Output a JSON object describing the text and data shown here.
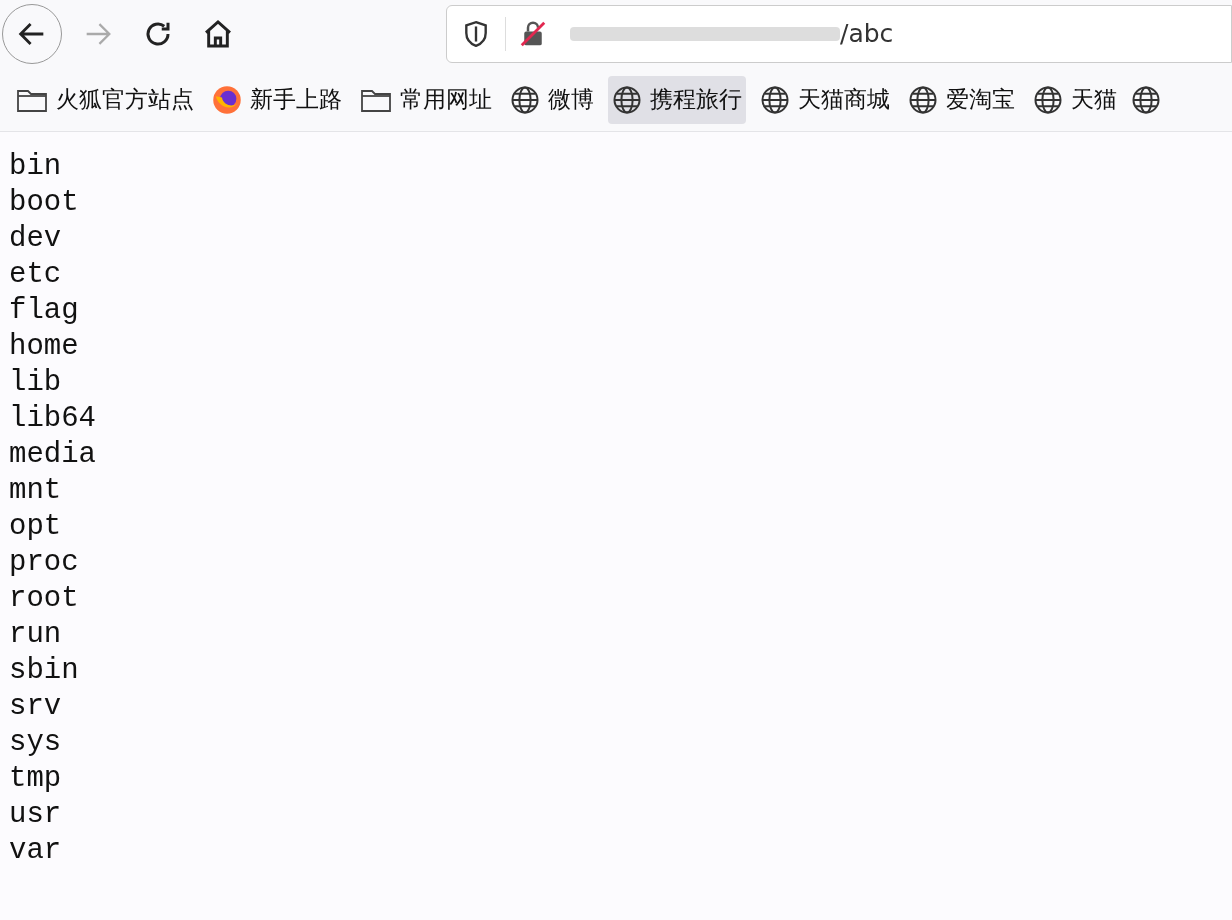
{
  "toolbar": {
    "back_enabled": true,
    "forward_enabled": false,
    "url": "/abc"
  },
  "bookmarks": [
    {
      "kind": "folder",
      "label": "火狐官方站点",
      "selected": false
    },
    {
      "kind": "firefox",
      "label": "新手上路",
      "selected": false
    },
    {
      "kind": "folder",
      "label": "常用网址",
      "selected": false
    },
    {
      "kind": "globe",
      "label": "微博",
      "selected": false
    },
    {
      "kind": "globe",
      "label": "携程旅行",
      "selected": true
    },
    {
      "kind": "globe",
      "label": "天猫商城",
      "selected": false
    },
    {
      "kind": "globe",
      "label": "爱淘宝",
      "selected": false
    },
    {
      "kind": "globe",
      "label": "天猫",
      "selected": false
    }
  ],
  "listing": [
    "bin",
    "boot",
    "dev",
    "etc",
    "flag",
    "home",
    "lib",
    "lib64",
    "media",
    "mnt",
    "opt",
    "proc",
    "root",
    "run",
    "sbin",
    "srv",
    "sys",
    "tmp",
    "usr",
    "var"
  ]
}
